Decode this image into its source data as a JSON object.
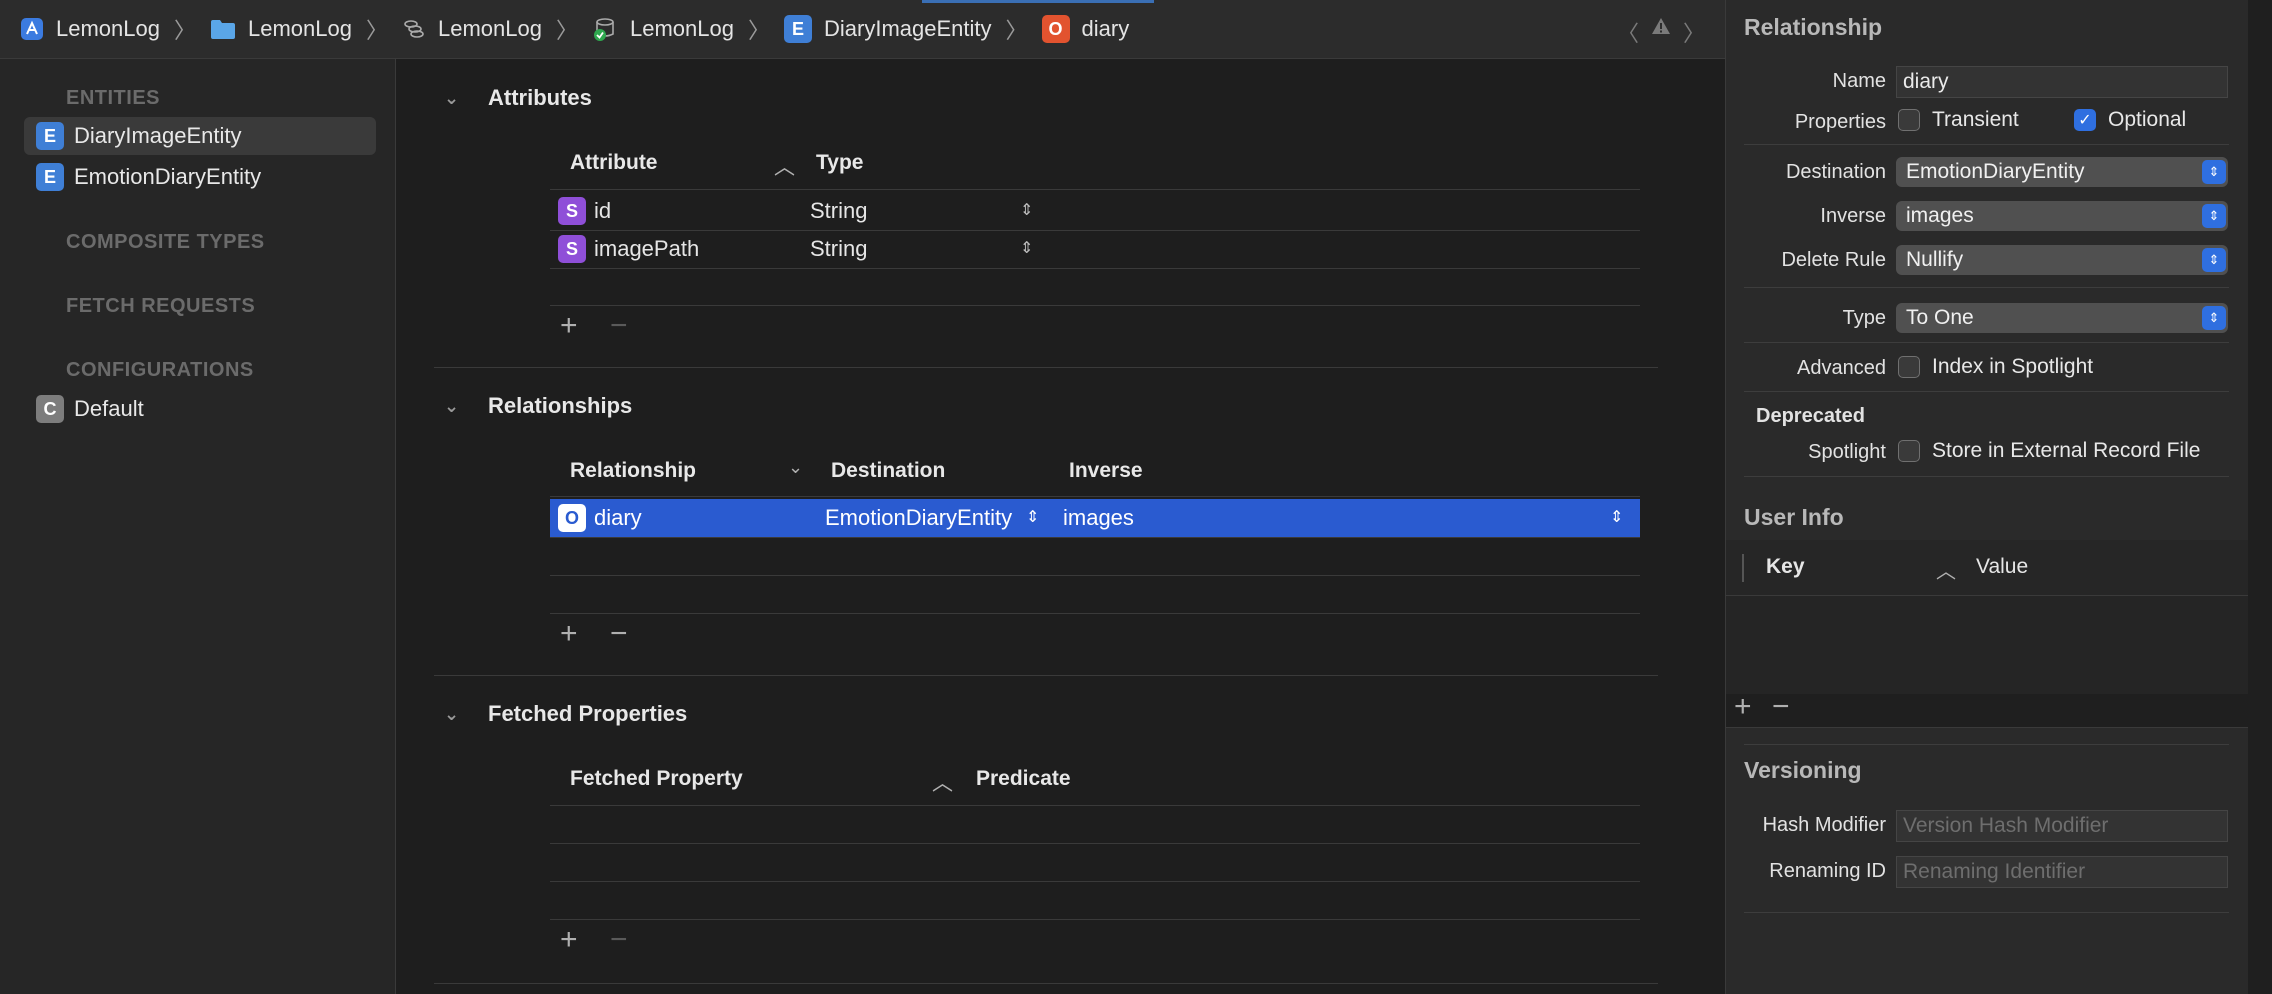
{
  "breadcrumbs": [
    {
      "label": "LemonLog",
      "icon": "app-icon"
    },
    {
      "label": "LemonLog",
      "icon": "folder-icon"
    },
    {
      "label": "LemonLog",
      "icon": "xcdatamodeld-icon"
    },
    {
      "label": "LemonLog",
      "icon": "datamodel-version-icon"
    },
    {
      "label": "DiaryImageEntity",
      "icon": "entity-badge",
      "badge": "E"
    },
    {
      "label": "diary",
      "icon": "relationship-badge",
      "badge": "O"
    }
  ],
  "sidebar": {
    "entities_header": "ENTITIES",
    "entities": [
      {
        "badge": "E",
        "label": "DiaryImageEntity",
        "selected": true
      },
      {
        "badge": "E",
        "label": "EmotionDiaryEntity",
        "selected": false
      }
    ],
    "composite_header": "COMPOSITE TYPES",
    "fetch_header": "FETCH REQUESTS",
    "config_header": "CONFIGURATIONS",
    "configurations": [
      {
        "badge": "C",
        "label": "Default"
      }
    ]
  },
  "attributes": {
    "title": "Attributes",
    "col_attribute": "Attribute",
    "col_type": "Type",
    "rows": [
      {
        "badge": "S",
        "name": "id",
        "type": "String"
      },
      {
        "badge": "S",
        "name": "imagePath",
        "type": "String"
      }
    ]
  },
  "relationships": {
    "title": "Relationships",
    "col_relationship": "Relationship",
    "col_destination": "Destination",
    "col_inverse": "Inverse",
    "rows": [
      {
        "badge": "O",
        "name": "diary",
        "destination": "EmotionDiaryEntity",
        "inverse": "images"
      }
    ]
  },
  "fetched": {
    "title": "Fetched Properties",
    "col_property": "Fetched Property",
    "col_predicate": "Predicate"
  },
  "inspector": {
    "relationship_header": "Relationship",
    "name_label": "Name",
    "name_value": "diary",
    "properties_label": "Properties",
    "transient_label": "Transient",
    "optional_label": "Optional",
    "destination_label": "Destination",
    "destination_value": "EmotionDiaryEntity",
    "inverse_label": "Inverse",
    "inverse_value": "images",
    "delete_rule_label": "Delete Rule",
    "delete_rule_value": "Nullify",
    "type_label": "Type",
    "type_value": "To One",
    "advanced_label": "Advanced",
    "index_spotlight_label": "Index in Spotlight",
    "deprecated_label": "Deprecated",
    "spotlight_label": "Spotlight",
    "store_external_label": "Store in External Record File",
    "user_info_header": "User Info",
    "key_col": "Key",
    "value_col": "Value",
    "versioning_header": "Versioning",
    "hash_modifier_label": "Hash Modifier",
    "hash_modifier_placeholder": "Version Hash Modifier",
    "renaming_id_label": "Renaming ID",
    "renaming_id_placeholder": "Renaming Identifier"
  },
  "colors": {
    "selection": "#2a5bd0",
    "entity_badge": "#3f7fd6",
    "relationship_badge": "#e2532f",
    "string_badge": "#8f4fd8"
  }
}
